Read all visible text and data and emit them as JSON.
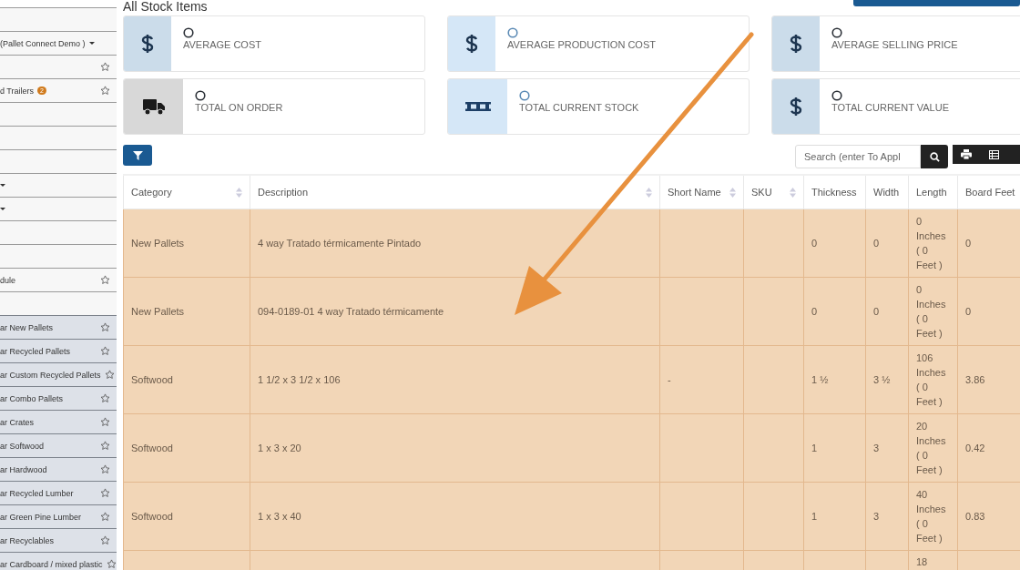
{
  "page_title": "All Stock Items",
  "sidebar": {
    "items": [
      {
        "kind": "blank"
      },
      {
        "kind": "link",
        "label": "(Pallet Connect Demo )",
        "caret": true,
        "star": false
      },
      {
        "kind": "link",
        "star": true,
        "caret": false
      },
      {
        "kind": "link",
        "label": "d Trailers",
        "badge": "2",
        "star": true,
        "caret": false
      },
      {
        "kind": "blank"
      },
      {
        "kind": "blank"
      },
      {
        "kind": "blank"
      },
      {
        "kind": "link",
        "caret": true,
        "star": false
      },
      {
        "kind": "link",
        "caret": true,
        "star": false
      },
      {
        "kind": "blank"
      },
      {
        "kind": "blank"
      },
      {
        "kind": "link",
        "label": "dule",
        "star": true,
        "caret": false
      },
      {
        "kind": "blank"
      },
      {
        "kind": "sub",
        "label": "ar New Pallets",
        "star": true,
        "caret": false
      },
      {
        "kind": "sub",
        "label": "ar Recycled Pallets",
        "star": true,
        "caret": false
      },
      {
        "kind": "sub",
        "label": "ar Custom Recycled Pallets",
        "star": true,
        "caret": false
      },
      {
        "kind": "sub",
        "label": "ar Combo Pallets",
        "star": true,
        "caret": false
      },
      {
        "kind": "sub",
        "label": "ar Crates",
        "star": true,
        "caret": false
      },
      {
        "kind": "sub",
        "label": "ar Softwood",
        "star": true,
        "caret": false
      },
      {
        "kind": "sub",
        "label": "ar Hardwood",
        "star": true,
        "caret": false
      },
      {
        "kind": "sub",
        "label": "ar Recycled Lumber",
        "star": true,
        "caret": false
      },
      {
        "kind": "sub",
        "label": "ar Green Pine Lumber",
        "star": true,
        "caret": false
      },
      {
        "kind": "sub",
        "label": "ar Recyclables",
        "star": true,
        "caret": false
      },
      {
        "kind": "sub",
        "label": "ar Cardboard / mixed plastic",
        "star": true,
        "caret": false
      }
    ]
  },
  "stats": [
    {
      "label": "AVERAGE COST",
      "kind": "dollar"
    },
    {
      "label": "AVERAGE PRODUCTION COST",
      "kind": "dollar-light"
    },
    {
      "label": "AVERAGE SELLING PRICE",
      "kind": "dollar"
    },
    {
      "label": "TOTAL ON ORDER",
      "kind": "truck"
    },
    {
      "label": "TOTAL CURRENT STOCK",
      "kind": "pallet"
    },
    {
      "label": "TOTAL CURRENT VALUE",
      "kind": "dollar"
    }
  ],
  "search": {
    "placeholder": "Search (enter To Appl"
  },
  "table": {
    "columns": [
      {
        "label": "Category",
        "sortable": true
      },
      {
        "label": "Description",
        "sortable": true
      },
      {
        "label": "Short Name",
        "sortable": true
      },
      {
        "label": "SKU",
        "sortable": true
      },
      {
        "label": "Thickness",
        "sortable": false
      },
      {
        "label": "Width",
        "sortable": false
      },
      {
        "label": "Length",
        "sortable": false
      },
      {
        "label": "Board Feet",
        "sortable": false
      }
    ],
    "rows": [
      [
        "New Pallets",
        "4 way Tratado térmicamente Pintado",
        "",
        "",
        "0",
        "0",
        "0 Inches ( 0 Feet )",
        "0"
      ],
      [
        "New Pallets",
        "094-0189-01 4 way Tratado térmicamente",
        "",
        "",
        "0",
        "0",
        "0 Inches ( 0 Feet )",
        "0"
      ],
      [
        "Softwood",
        "1 1/2 x 3 1/2 x 106",
        "-",
        "",
        "1 ½",
        "3 ½",
        "106 Inches ( 0 Feet )",
        "3.86"
      ],
      [
        "Softwood",
        "1 x 3 x 20",
        "",
        "",
        "1",
        "3",
        "20 Inches ( 0 Feet )",
        "0.42"
      ],
      [
        "Softwood",
        "1 x 3 x 40",
        "",
        "",
        "1",
        "3",
        "40 Inches ( 0 Feet )",
        "0.83"
      ],
      [
        "",
        "",
        "",
        "",
        "",
        "",
        "18",
        ""
      ]
    ]
  }
}
